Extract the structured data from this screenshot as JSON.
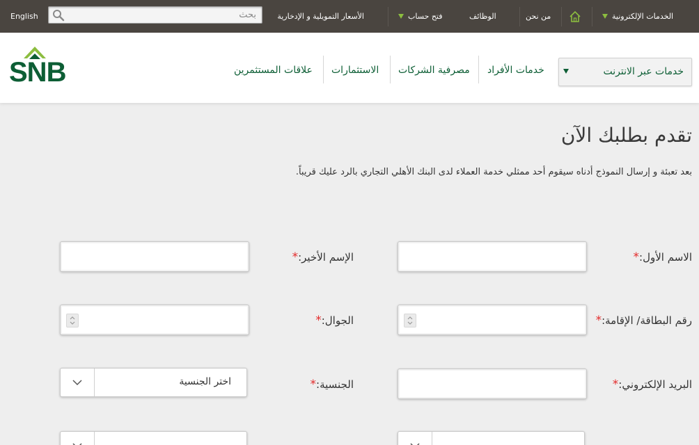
{
  "topbar": {
    "language_link": "English",
    "search_placeholder": "بحث",
    "rates_link": "الأسعار التمويلية و الإدخارية",
    "open_account": "فتح حساب",
    "jobs": "الوظائف",
    "about": "من نحن",
    "eservices": "الخدمات الإلكترونية"
  },
  "header": {
    "logo_text": "SNB",
    "online_services": "خدمات عبر الانترنت",
    "nav": {
      "individuals": "خدمات الأفراد",
      "corporate": "مصرفية الشركات",
      "investments": "الاستثمارات",
      "investor_relations": "علاقات المستثمرين"
    }
  },
  "main": {
    "title": "تقدم بطلبك الآن",
    "intro": "بعد تعبئة و إرسال النموذج أدناه سيقوم أحد ممثلي خدمة العملاء لدى البنك الأهلي التجاري بالرد عليك قريباً."
  },
  "form": {
    "required_mark": "*",
    "first_name": {
      "label": "الاسم الأول:",
      "value": ""
    },
    "last_name": {
      "label": "الإسم الأخير:",
      "value": ""
    },
    "id_number": {
      "label": "رقم البطاقة/ الإقامة:",
      "value": ""
    },
    "mobile": {
      "label": "الجوال:",
      "value": ""
    },
    "email": {
      "label": "البريد الإلكتروني:",
      "value": ""
    },
    "nationality": {
      "label": "الجنسية:",
      "value": "اختر الجنسية"
    }
  },
  "colors": {
    "topbar_bg": "#4a4540",
    "brand_green": "#0d5e35",
    "accent_green": "#8cbd3f",
    "required_red": "#e32b2b"
  },
  "icons": [
    "search-icon",
    "home-icon",
    "snb-logo",
    "chevron-down-icon",
    "spinner-icon"
  ]
}
